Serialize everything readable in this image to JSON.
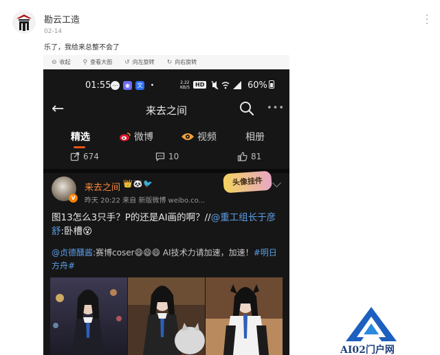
{
  "author": {
    "name": "勘云工造",
    "date": "02-14"
  },
  "post_text": "乐了，我给来总整不会了",
  "image_toolbar": [
    {
      "icon": "collapse-icon",
      "label": "收起"
    },
    {
      "icon": "zoom-icon",
      "label": "查看大图"
    },
    {
      "icon": "rotate-left-icon",
      "label": "向左旋转"
    },
    {
      "icon": "rotate-right-icon",
      "label": "向右旋转"
    }
  ],
  "phone": {
    "status_bar": {
      "time": "01:55",
      "speed_top": "2.22",
      "speed_bottom": "KB/S",
      "hd": "HD",
      "battery": "60%"
    },
    "page_title": "来去之间",
    "tabs": [
      {
        "label": "精选",
        "active": true
      },
      {
        "label": "微博"
      },
      {
        "label": "视频"
      },
      {
        "label": "相册"
      }
    ],
    "stats": {
      "reposts": "674",
      "comments": "10",
      "likes": "81"
    },
    "post": {
      "name": "来去之间",
      "meta": "昨天 20:22  来自 新版微博 weibo.co...",
      "badge": "V",
      "sticker": "头像挂件",
      "body_start": "图13怎么3只手？P的还是AI画的啊？//",
      "body_link": "@重工组长于彦舒",
      "body_end": ":卧槽",
      "repost_link": "@贞德醺酱",
      "repost_text": ":赛博coser",
      "repost_text2": " AI技术力请加速，加速！",
      "repost_tag": "#明日方舟#"
    }
  },
  "watermark": {
    "text": "AI02门户网"
  },
  "colors": {
    "accent": "#e8541b",
    "link": "#5b9ee6",
    "username": "#ff8a3c",
    "dark_bg": "#161616"
  }
}
